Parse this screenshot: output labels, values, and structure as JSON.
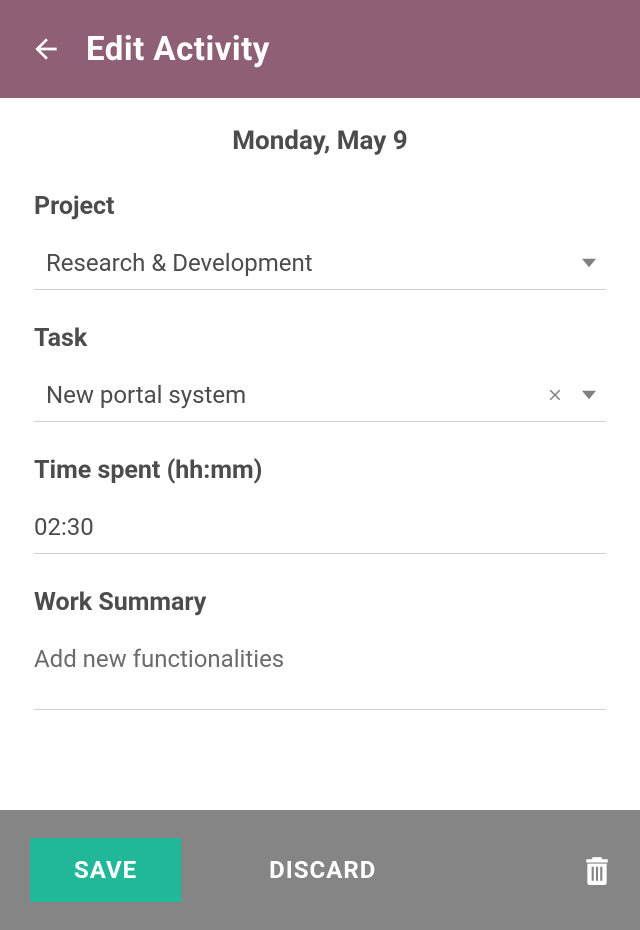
{
  "header": {
    "title": "Edit Activity"
  },
  "form": {
    "date": "Monday, May 9",
    "project": {
      "label": "Project",
      "value": "Research & Development"
    },
    "task": {
      "label": "Task",
      "value": "New portal system"
    },
    "timeSpent": {
      "label": "Time spent (hh:mm)",
      "value": "02:30"
    },
    "workSummary": {
      "label": "Work Summary",
      "value": "Add new functionalities"
    }
  },
  "footer": {
    "save": "SAVE",
    "discard": "DISCARD"
  }
}
